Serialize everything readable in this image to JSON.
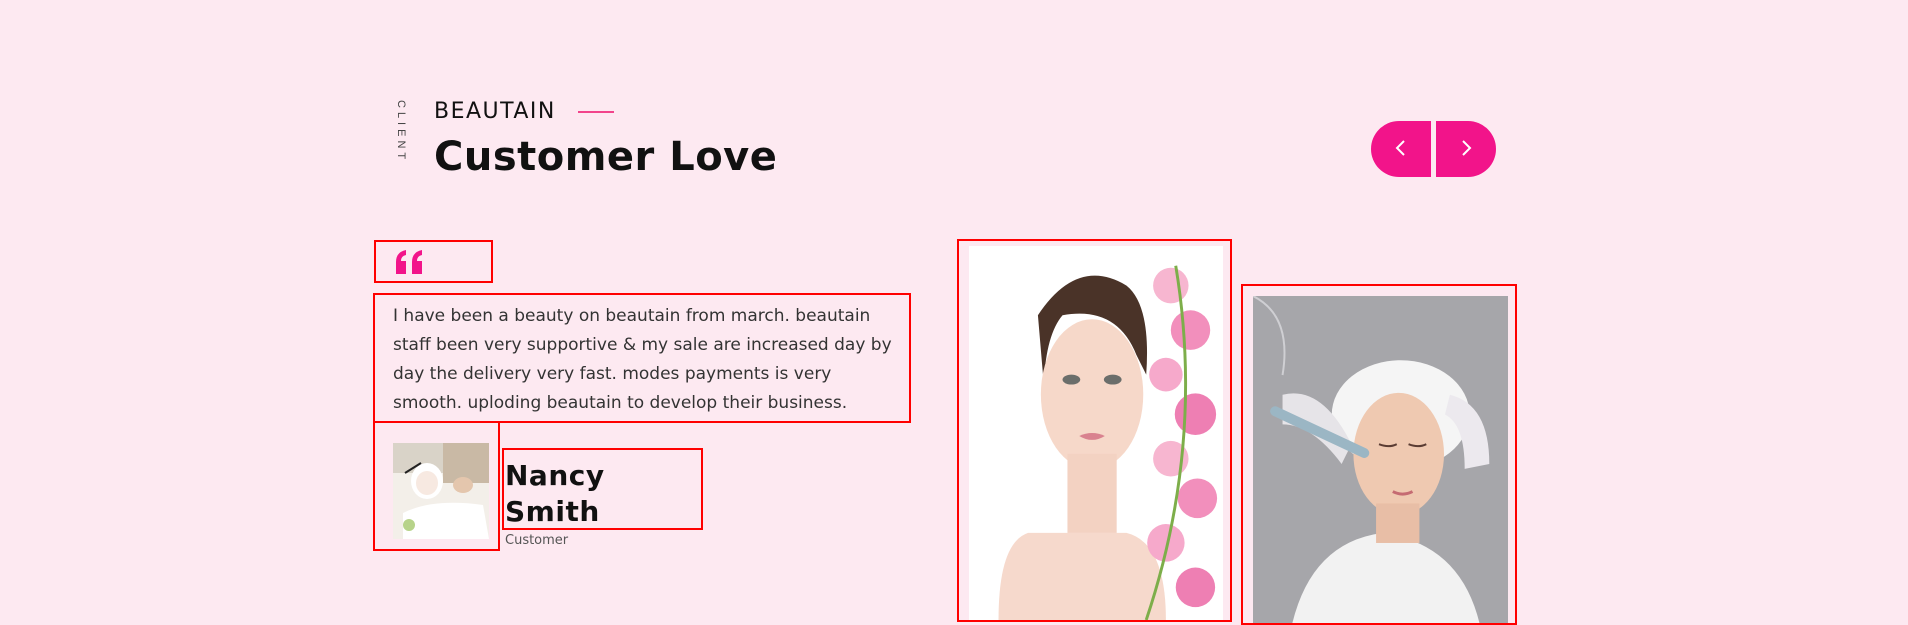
{
  "section": {
    "vertical_label": "CLIENT",
    "kicker": "BEAUTAIN",
    "title": "Customer Love"
  },
  "nav": {
    "prev_icon": "chevron-left-icon",
    "next_icon": "chevron-right-icon"
  },
  "testimonial": {
    "quote_icon": "quote-icon",
    "text": "I have been a beauty on beautain from march. beautain staff been very supportive & my sale are increased day by day the delivery very fast. modes payments is very smooth. uploding beautain to develop their business.",
    "author_name": "Nancy Smith",
    "author_role": "Customer"
  },
  "images": {
    "avatar": "facial-mask-avatar",
    "photo_1": "woman-with-orchids-photo",
    "photo_2": "facial-treatment-photo"
  },
  "colors": {
    "accent": "#f2148a",
    "background": "#fde9f1",
    "outline": "#ff0000"
  }
}
